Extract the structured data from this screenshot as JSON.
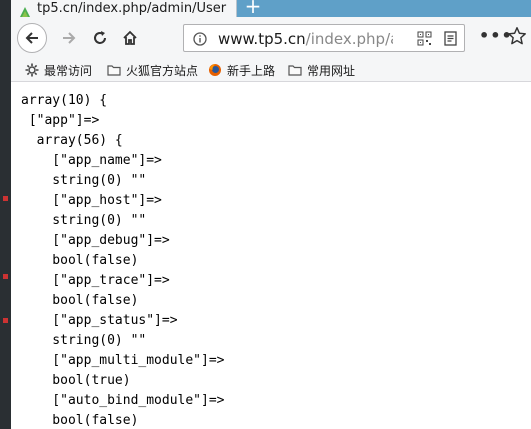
{
  "tab": {
    "title": "tp5.cn/index.php/admin/User",
    "new_tab_label": "+"
  },
  "toolbar": {
    "url_host": "www.tp5.cn",
    "url_path": "/index.php/a",
    "more_label": "•••"
  },
  "bookmarks": {
    "items": [
      {
        "label": "最常访问",
        "icon": "gear-icon"
      },
      {
        "label": "火狐官方站点",
        "icon": "folder-icon"
      },
      {
        "label": "新手上路",
        "icon": "firefox-icon"
      },
      {
        "label": "常用网址",
        "icon": "folder-icon"
      }
    ]
  },
  "content": {
    "lines": [
      "array(10) {",
      " [\"app\"]=>",
      "  array(56) {",
      "    [\"app_name\"]=>",
      "    string(0) \"\"",
      "    [\"app_host\"]=>",
      "    string(0) \"\"",
      "    [\"app_debug\"]=>",
      "    bool(false)",
      "    [\"app_trace\"]=>",
      "    bool(false)",
      "    [\"app_status\"]=>",
      "    string(0) \"\"",
      "    [\"app_multi_module\"]=>",
      "    bool(true)",
      "    [\"auto_bind_module\"]=>",
      "    bool(false)"
    ]
  },
  "colors": {
    "tab_strip": "#5fa0c8",
    "toolbar_bg": "#f5f6f7",
    "text": "#1b1b1b"
  }
}
